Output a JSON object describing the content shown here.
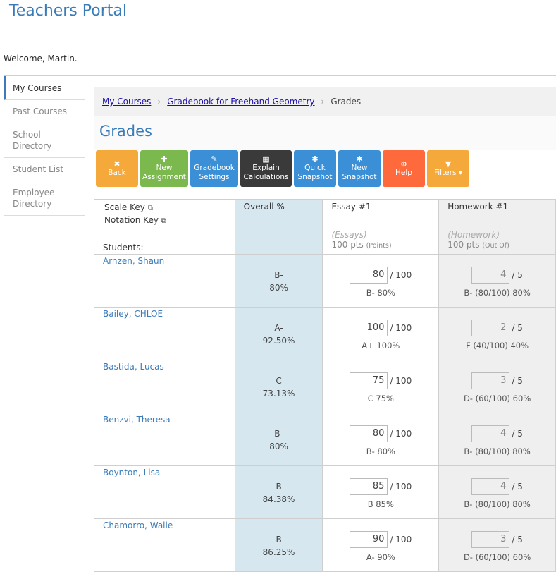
{
  "app": {
    "title": "Teachers Portal",
    "welcome": "Welcome, Martin."
  },
  "sidebar": {
    "items": [
      {
        "label": "My Courses",
        "active": true
      },
      {
        "label": "Past Courses"
      },
      {
        "label": "School Directory"
      },
      {
        "label": "Student List"
      },
      {
        "label": "Employee Directory"
      }
    ]
  },
  "breadcrumb": {
    "item1": "My Courses",
    "item2": "Gradebook for Freehand Geometry",
    "current": "Grades"
  },
  "page_title": "Grades",
  "toolbar": {
    "back": {
      "icon": "✖",
      "label": "Back",
      "color": "#f6a93b"
    },
    "new_assignment": {
      "icon": "✚",
      "l1": "New",
      "l2": "Assignment",
      "color": "#7bb84e"
    },
    "gradebook_settings": {
      "icon": "✎",
      "l1": "Gradebook",
      "l2": "Settings",
      "color": "#3a8fd6"
    },
    "explain": {
      "icon": "▦",
      "l1": "Explain",
      "l2": "Calculations",
      "color": "#3a3a3a"
    },
    "quick_snapshot": {
      "icon": "✱",
      "l1": "Quick",
      "l2": "Snapshot",
      "color": "#3a8fd6"
    },
    "new_snapshot": {
      "icon": "✱",
      "l1": "New",
      "l2": "Snapshot",
      "color": "#3a8fd6"
    },
    "help": {
      "icon": "⊕",
      "label": "Help",
      "color": "#ff6a3d"
    },
    "filters": {
      "icon": "▼",
      "label": "Filters ▾",
      "color": "#f6a93b"
    }
  },
  "table": {
    "scale_key": "Scale Key",
    "notation_key": "Notation Key",
    "students_label": "Students:",
    "overall_header": "Overall %",
    "essay": {
      "name": "Essay #1",
      "category": "(Essays)",
      "pts": "100 pts",
      "pts_note": "(Points)"
    },
    "homework": {
      "name": "Homework #1",
      "category": "(Homework)",
      "pts": "100 pts",
      "pts_note": "(Out Of)"
    },
    "rows": [
      {
        "name": "Arnzen, Shaun",
        "grade": "B-",
        "pct": "80%",
        "essay_score": "80",
        "essay_max": "/ 100",
        "essay_result": "B- 80%",
        "hw_score": "4",
        "hw_max": "/ 5",
        "hw_result": "B- (80/100) 80%"
      },
      {
        "name": "Bailey, CHLOE",
        "grade": "A-",
        "pct": "92.50%",
        "essay_score": "100",
        "essay_max": "/ 100",
        "essay_result": "A+ 100%",
        "hw_score": "2",
        "hw_max": "/ 5",
        "hw_result": "F (40/100) 40%"
      },
      {
        "name": "Bastida, Lucas",
        "grade": "C",
        "pct": "73.13%",
        "essay_score": "75",
        "essay_max": "/ 100",
        "essay_result": "C 75%",
        "hw_score": "3",
        "hw_max": "/ 5",
        "hw_result": "D- (60/100) 60%"
      },
      {
        "name": "Benzvi, Theresa",
        "grade": "B-",
        "pct": "80%",
        "essay_score": "80",
        "essay_max": "/ 100",
        "essay_result": "B- 80%",
        "hw_score": "4",
        "hw_max": "/ 5",
        "hw_result": "B- (80/100) 80%"
      },
      {
        "name": "Boynton, Lisa",
        "grade": "B",
        "pct": "84.38%",
        "essay_score": "85",
        "essay_max": "/ 100",
        "essay_result": "B 85%",
        "hw_score": "4",
        "hw_max": "/ 5",
        "hw_result": "B- (80/100) 80%"
      },
      {
        "name": "Chamorro, Walle",
        "grade": "B",
        "pct": "86.25%",
        "essay_score": "90",
        "essay_max": "/ 100",
        "essay_result": "A- 90%",
        "hw_score": "3",
        "hw_max": "/ 5",
        "hw_result": "D- (60/100) 60%"
      }
    ]
  }
}
